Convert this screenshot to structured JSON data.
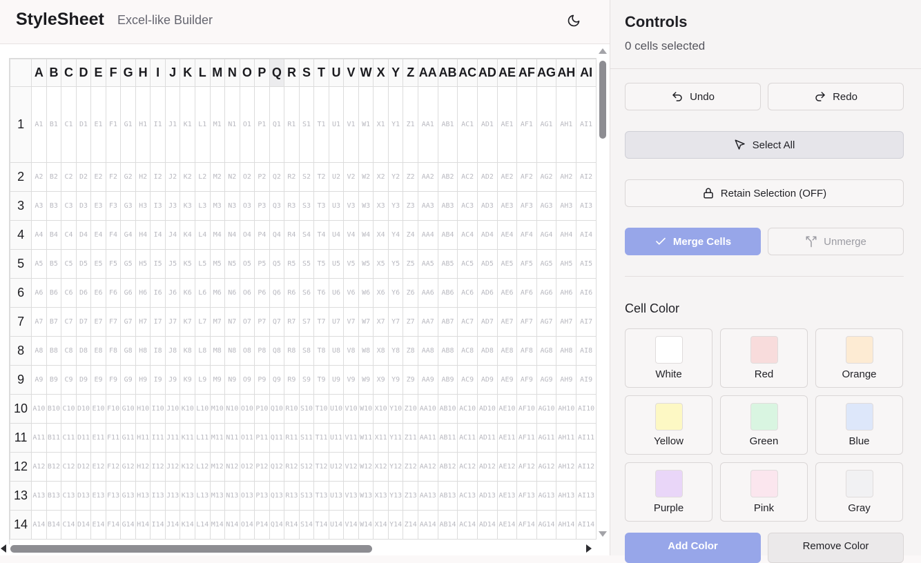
{
  "header": {
    "title": "StyleSheet",
    "subtitle": "Excel-like Builder",
    "theme_icon": "moon-icon"
  },
  "sheet": {
    "columns": [
      "A",
      "B",
      "C",
      "D",
      "E",
      "F",
      "G",
      "H",
      "I",
      "J",
      "K",
      "L",
      "M",
      "N",
      "O",
      "P",
      "Q",
      "R",
      "S",
      "T",
      "U",
      "V",
      "W",
      "X",
      "Y",
      "Z",
      "AA",
      "AB",
      "AC",
      "AD",
      "AE",
      "AF",
      "AG",
      "AH",
      "AI"
    ],
    "highlighted_column": "Q",
    "rows": [
      "1",
      "2",
      "3",
      "4",
      "5",
      "6",
      "7",
      "8",
      "9",
      "10",
      "11",
      "12",
      "13",
      "14"
    ]
  },
  "panel": {
    "title": "Controls",
    "selection_status": "0 cells selected",
    "undo_label": "Undo",
    "redo_label": "Redo",
    "select_all_label": "Select All",
    "retain_selection_label": "Retain Selection (OFF)",
    "merge_label": "Merge Cells",
    "unmerge_label": "Unmerge",
    "cell_color_title": "Cell Color",
    "colors": [
      {
        "label": "White",
        "hex": "#ffffff"
      },
      {
        "label": "Red",
        "hex": "#f8dcdc"
      },
      {
        "label": "Orange",
        "hex": "#fdebd3"
      },
      {
        "label": "Yellow",
        "hex": "#fdf8c4"
      },
      {
        "label": "Green",
        "hex": "#d9f5e1"
      },
      {
        "label": "Blue",
        "hex": "#dde7fa"
      },
      {
        "label": "Purple",
        "hex": "#e9d6f8"
      },
      {
        "label": "Pink",
        "hex": "#fbe6ee"
      },
      {
        "label": "Gray",
        "hex": "#f1f1f3"
      }
    ],
    "add_color_label": "Add Color",
    "remove_color_label": "Remove Color"
  },
  "theme": {
    "accent": "#97a6e9",
    "grid_border": "#dcdcdc",
    "cell_text": "#b9b9c0"
  }
}
